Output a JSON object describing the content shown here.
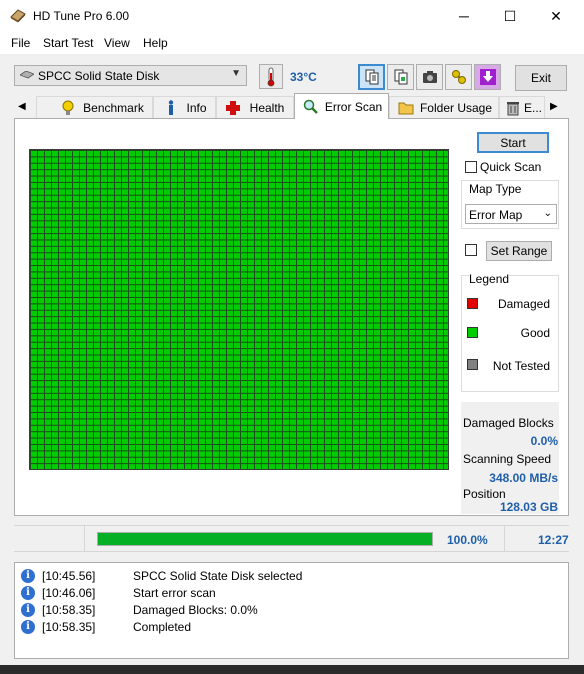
{
  "window": {
    "title": "HD Tune Pro 6.00",
    "minimize": "─",
    "maximize": "☐",
    "close": "✕"
  },
  "menu": [
    "File",
    "Start Test",
    "View",
    "Help"
  ],
  "toolbar": {
    "drive": "SPCC Solid State Disk",
    "temperature": "33°C",
    "exit_label": "Exit",
    "buttons": [
      "copy-text-icon",
      "copy-image-icon",
      "camera-icon",
      "options-icon",
      "save-icon"
    ]
  },
  "tabs": [
    {
      "label": "Benchmark",
      "icon": "bulb-icon"
    },
    {
      "label": "Info",
      "icon": "info-icon"
    },
    {
      "label": "Health",
      "icon": "health-cross-icon"
    },
    {
      "label": "Error Scan",
      "icon": "magnifier-icon",
      "active": true
    },
    {
      "label": "Folder Usage",
      "icon": "folder-icon"
    },
    {
      "label": "E...",
      "icon": "trash-icon"
    }
  ],
  "error_scan": {
    "start_label": "Start",
    "quick_scan_label": "Quick Scan",
    "quick_scan_checked": false,
    "map_type_title": "Map Type",
    "map_type_value": "Error Map",
    "set_range_checked": false,
    "set_range_label": "Set Range",
    "legend_title": "Legend",
    "legend": [
      {
        "label": "Damaged",
        "color": "#e00000"
      },
      {
        "label": "Good",
        "color": "#00cc00"
      },
      {
        "label": "Not Tested",
        "color": "#808080"
      }
    ],
    "map_color": "#00cc00",
    "stats": {
      "damaged_blocks_label": "Damaged Blocks",
      "damaged_blocks_value": "0.0%",
      "speed_label": "Scanning Speed",
      "speed_value": "348.00 MB/s",
      "position_label": "Position",
      "position_value": "128.03 GB"
    }
  },
  "progress": {
    "fraction": 1.0,
    "percent_text": "100.0%",
    "elapsed": "12:27"
  },
  "log": [
    {
      "time": "[10:45.56]",
      "message": "SPCC Solid State Disk selected"
    },
    {
      "time": "[10:46.06]",
      "message": "Start error scan"
    },
    {
      "time": "[10:58.35]",
      "message": "Damaged Blocks: 0.0%"
    },
    {
      "time": "[10:58.35]",
      "message": "Completed"
    }
  ]
}
